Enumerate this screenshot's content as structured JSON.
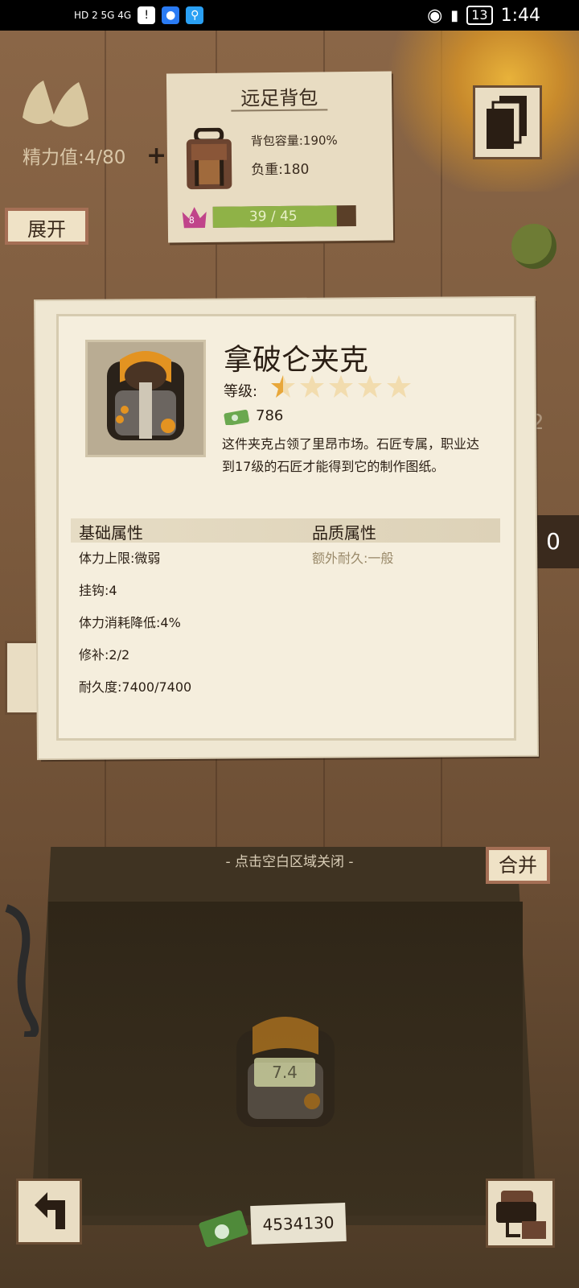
{
  "status_bar": {
    "network": "HD 2  5G  4G",
    "time": "1:44",
    "battery": "13"
  },
  "top": {
    "energy_text": "精力值:4/80",
    "expand_label": "展开"
  },
  "backpack": {
    "title": "远足背包",
    "capacity": "背包容量:190%",
    "load": "负重:180",
    "level": "8",
    "progress_text": "39 / 45",
    "progress": {
      "current": 39,
      "max": 45
    }
  },
  "item": {
    "name": "拿破仑夹克",
    "grade_label": "等级:",
    "stars_total": 5,
    "stars_filled": 0.5,
    "price": "786",
    "description": "这件夹克占领了里昂市场。石匠专属，职业达到17级的石匠才能得到它的制作图纸。",
    "base_header": "基础属性",
    "quality_header": "品质属性",
    "base_attrs": [
      "体力上限:微弱",
      "挂钩:4",
      "体力消耗降低:4%",
      "修补:2/2",
      "耐久度:7400/7400"
    ],
    "quality_attrs": [
      "额外耐久:一般"
    ]
  },
  "side": {
    "right_count": "0",
    "right_faded": "2"
  },
  "bottom": {
    "hint": "- 点击空白区域关闭 -",
    "merge_label": "合并",
    "ghost_value": "7.4",
    "money": "4534130"
  },
  "colors": {
    "star_gold": "#e8a73a",
    "progress_green": "#8fb247",
    "level_badge": "#c0448a"
  }
}
